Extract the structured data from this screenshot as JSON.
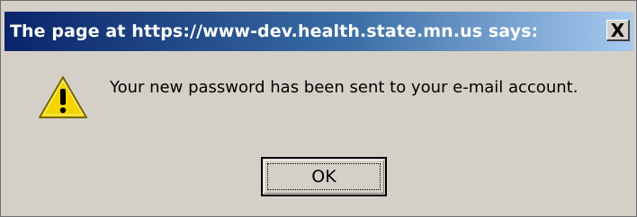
{
  "dialog": {
    "title": "The page at https://www-dev.health.state.mn.us says:",
    "close_label": "X",
    "message": "Your new password has been sent to your e-mail account.",
    "icon": "warning-icon",
    "ok_label": "OK"
  },
  "colors": {
    "titlebar_start": "#0a246a",
    "titlebar_end": "#a6caf0",
    "dialog_bg": "#d4d0c8",
    "warning_yellow": "#f5d400"
  }
}
